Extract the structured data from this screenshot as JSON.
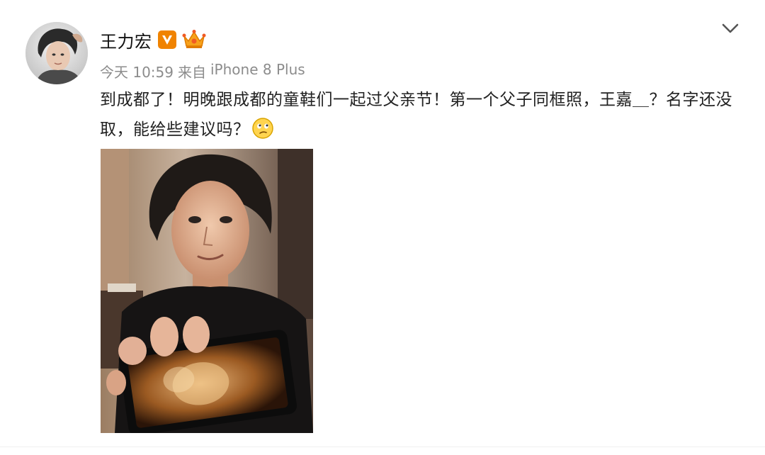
{
  "post": {
    "author": "王力宏",
    "meta": {
      "time": "今天 10:59",
      "source_prefix": "来自",
      "device": "iPhone 8 Plus"
    },
    "text": "到成都了！明晚跟成都的童鞋们一起过父亲节！第一个父子同框照，王嘉＿？名字还没取，能给些建议吗？"
  },
  "icons": {
    "verified": "verified-v-icon",
    "member": "crown-member-icon",
    "menu": "chevron-down-icon",
    "emoji": "thinking-face-emoji-icon"
  },
  "colors": {
    "verified": "#f08300",
    "meta": "#8c8c8c",
    "text": "#222222"
  }
}
